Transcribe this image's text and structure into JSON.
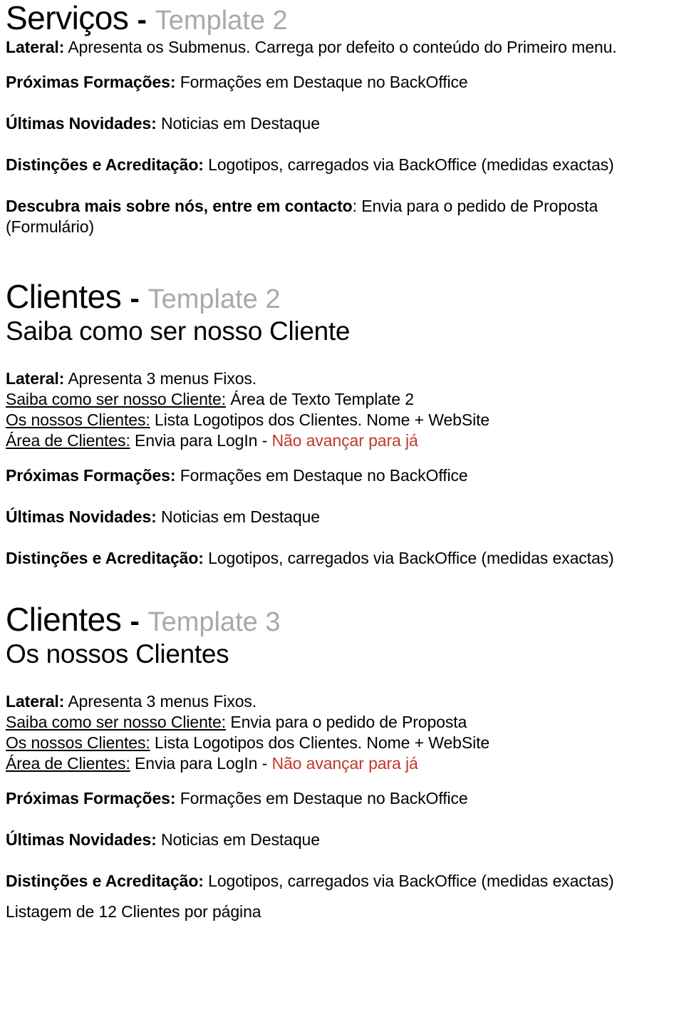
{
  "document": {
    "colors": {
      "text": "#000000",
      "muted": "#a9a9a9",
      "accent_red": "#c0392b",
      "background": "#ffffff"
    }
  },
  "section_servicos": {
    "title_main": "Serviços",
    "title_dash": "-",
    "title_template": "Template 2",
    "lateral_label": "Lateral:",
    "lateral_text": " Apresenta os Submenus. Carrega por defeito o conteúdo do Primeiro menu.",
    "items": [
      {
        "label": "Próximas Formações:",
        "text": " Formações em Destaque no BackOffice"
      },
      {
        "label": "Últimas Novidades:",
        "text": " Noticias em Destaque"
      },
      {
        "label": "Distinções e Acreditação:",
        "text": " Logotipos, carregados via BackOffice (medidas exactas)"
      },
      {
        "label": "Descubra mais sobre nós, entre em contacto",
        "text": ": Envia para o pedido de Proposta"
      }
    ],
    "formulario": "(Formulário)"
  },
  "section_clientes_t2": {
    "title_main": "Clientes",
    "title_dash": "-",
    "title_template": "Template 2",
    "subtitle": "Saiba como ser nosso Cliente",
    "lateral_label": "Lateral:",
    "lateral_text": " Apresenta 3 menus Fixos.",
    "menus": [
      {
        "label": "Saiba como ser nosso Cliente:",
        "text": " Área de Texto Template 2",
        "red": ""
      },
      {
        "label": "Os nossos Clientes:",
        "text": " Lista Logotipos dos Clientes. Nome + WebSite",
        "red": ""
      },
      {
        "label": "Área de Clientes:",
        "text": " Envia para LogIn - ",
        "red": "Não avançar para já"
      }
    ],
    "items": [
      {
        "label": "Próximas Formações:",
        "text": " Formações em Destaque no BackOffice"
      },
      {
        "label": "Últimas Novidades:",
        "text": " Noticias em Destaque"
      },
      {
        "label": "Distinções e Acreditação:",
        "text": " Logotipos, carregados via BackOffice (medidas exactas)"
      }
    ]
  },
  "section_clientes_t3": {
    "title_main": "Clientes",
    "title_dash": "-",
    "title_template": "Template 3",
    "subtitle": "Os nossos Clientes",
    "lateral_label": "Lateral:",
    "lateral_text": " Apresenta 3 menus Fixos.",
    "menus": [
      {
        "label": "Saiba como ser nosso Cliente:",
        "text": " Envia para o pedido de Proposta",
        "red": ""
      },
      {
        "label": "Os nossos Clientes:",
        "text": " Lista Logotipos dos Clientes. Nome + WebSite",
        "red": ""
      },
      {
        "label": "Área de Clientes:",
        "text": " Envia para LogIn - ",
        "red": "Não avançar para já"
      }
    ],
    "items": [
      {
        "label": "Próximas Formações:",
        "text": " Formações em Destaque no BackOffice"
      },
      {
        "label": "Últimas Novidades:",
        "text": " Noticias em Destaque"
      },
      {
        "label": "Distinções e Acreditação:",
        "text": " Logotipos, carregados via BackOffice (medidas exactas)"
      }
    ],
    "footer_note": "Listagem de 12 Clientes por página"
  }
}
